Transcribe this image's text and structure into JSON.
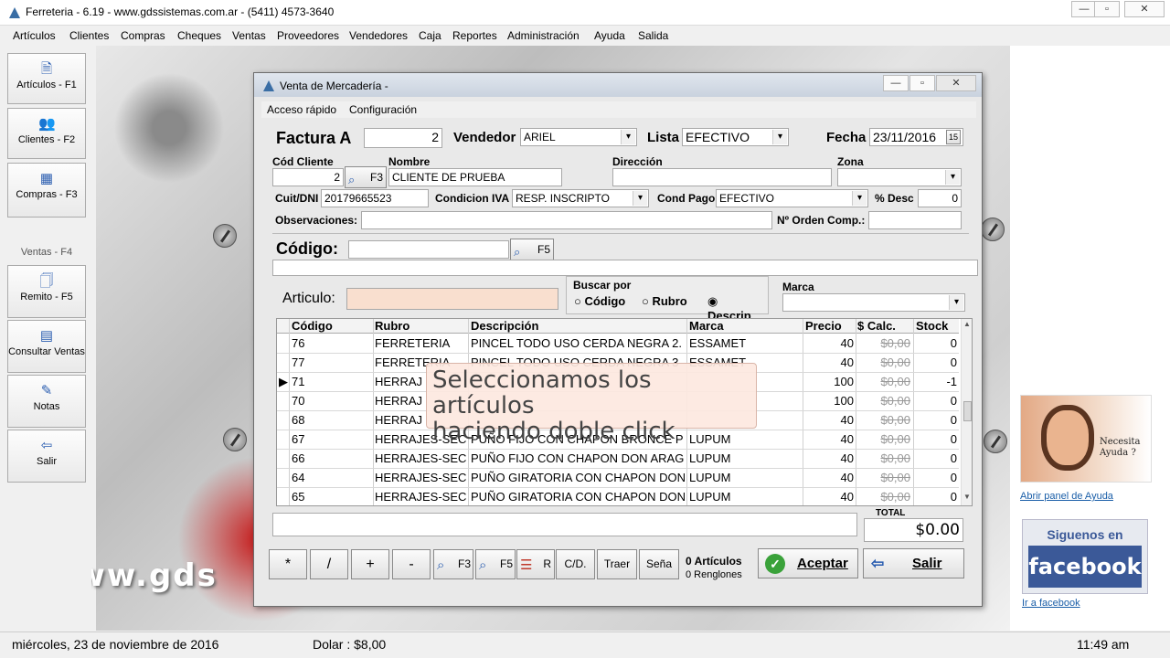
{
  "app": {
    "title": "Ferreteria  -  6.19 - www.gdssistemas.com.ar  -  (5411) 4573-3640"
  },
  "menu": [
    "Artículos",
    "Clientes",
    "Compras",
    "Cheques",
    "Ventas",
    "Proveedores",
    "Vendedores",
    "Caja",
    "Reportes",
    "Administración",
    "Ayuda",
    "Salida"
  ],
  "sidebar": [
    {
      "label": "Artículos - F1",
      "icon": "articles-icon",
      "glyph": "🗎"
    },
    {
      "label": "Clientes - F2",
      "icon": "clients-icon",
      "glyph": "👥"
    },
    {
      "label": "Compras - F3",
      "icon": "purchases-icon",
      "glyph": "▦"
    },
    {
      "label": "Ventas - F4",
      "icon": "",
      "glyph": ""
    },
    {
      "label": "Remito - F5",
      "icon": "delivery-note-icon",
      "glyph": "🗍"
    },
    {
      "label": "Consultar Ventas",
      "icon": "query-sales-icon",
      "glyph": "▤"
    },
    {
      "label": "Notas",
      "icon": "notes-icon",
      "glyph": "✎"
    },
    {
      "label": "Salir",
      "icon": "exit-icon",
      "glyph": "⇦"
    }
  ],
  "watermark": "www.gds",
  "dialog": {
    "title": "Venta de Mercadería -",
    "menu": [
      "Acceso rápido",
      "Configuración"
    ],
    "factura_label": "Factura A",
    "factura_num": "2",
    "vendedor_label": "Vendedor",
    "vendedor_value": "ARIEL",
    "lista_label": "Lista",
    "lista_value": "EFECTIVO",
    "fecha_label": "Fecha",
    "fecha_value": "23/11/2016",
    "calendar_glyph": "15",
    "cod_cliente_label": "Cód Cliente",
    "cod_cliente_value": "2",
    "f3_label": "F3",
    "nombre_label": "Nombre",
    "nombre_value": "CLIENTE DE PRUEBA",
    "direccion_label": "Dirección",
    "direccion_value": "",
    "zona_label": "Zona",
    "zona_value": "",
    "cuit_label": "Cuit/DNI",
    "cuit_value": "20179665523",
    "condicion_iva_label": "Condicion IVA",
    "condicion_iva_value": "RESP. INSCRIPTO",
    "cond_pago_label": "Cond Pago",
    "cond_pago_value": "EFECTIVO",
    "desc_label": "% Desc",
    "desc_value": "0",
    "observaciones_label": "Observaciones:",
    "observaciones_value": "",
    "orden_label": "Nº Orden Comp.:",
    "orden_value": "",
    "codigo_label": "Código:",
    "codigo_value": "",
    "f5_label": "F5",
    "articulo_label": "Articulo:",
    "articulo_value": "",
    "buscar_por_label": "Buscar por",
    "buscar_options": [
      "Código",
      "Rubro",
      "Descrip."
    ],
    "marca_label": "Marca",
    "marca_value": "",
    "columns": [
      "Código",
      "Rubro",
      "Descripción",
      "Marca",
      "Precio",
      "$ Calc.",
      "Stock"
    ],
    "rows": [
      {
        "codigo": "76",
        "rubro": "FERRETERIA",
        "descripcion": "PINCEL TODO USO CERDA NEGRA 2.",
        "marca": "ESSAMET",
        "precio": "40",
        "calc": "$0,00",
        "stock": "0"
      },
      {
        "codigo": "77",
        "rubro": "FERRETERIA",
        "descripcion": "PINCEL TODO USO CERDA NEGRA 3",
        "marca": "ESSAMET",
        "precio": "40",
        "calc": "$0,00",
        "stock": "0"
      },
      {
        "codigo": "71",
        "rubro": "HERRAJ",
        "descripcion": "",
        "marca": "",
        "precio": "100",
        "calc": "$0,00",
        "stock": "-1",
        "current": "▶"
      },
      {
        "codigo": "70",
        "rubro": "HERRAJ",
        "descripcion": "",
        "marca": "",
        "precio": "100",
        "calc": "$0,00",
        "stock": "0"
      },
      {
        "codigo": "68",
        "rubro": "HERRAJ",
        "descripcion": "",
        "marca": "",
        "precio": "40",
        "calc": "$0,00",
        "stock": "0"
      },
      {
        "codigo": "67",
        "rubro": "HERRAJES-SEC",
        "descripcion": "PUÑO FIJO CON CHAPON BRONCE P",
        "marca": "LUPUM",
        "precio": "40",
        "calc": "$0,00",
        "stock": "0"
      },
      {
        "codigo": "66",
        "rubro": "HERRAJES-SEC",
        "descripcion": "PUÑO FIJO CON CHAPON DON ARAG",
        "marca": "LUPUM",
        "precio": "40",
        "calc": "$0,00",
        "stock": "0"
      },
      {
        "codigo": "64",
        "rubro": "HERRAJES-SEC",
        "descripcion": "PUÑO GIRATORIA CON CHAPON DON",
        "marca": "LUPUM",
        "precio": "40",
        "calc": "$0,00",
        "stock": "0"
      },
      {
        "codigo": "65",
        "rubro": "HERRAJES-SEC",
        "descripcion": "PUÑO GIRATORIA CON CHAPON DON",
        "marca": "LUPUM",
        "precio": "40",
        "calc": "$0,00",
        "stock": "0"
      }
    ],
    "tooltip_line1": "Seleccionamos los artículos",
    "tooltip_line2": "haciendo doble click",
    "total_label": "TOTAL",
    "total_value": "$0.00",
    "bottom_buttons": [
      "*",
      "/",
      "+",
      "-"
    ],
    "f3_btn": "F3",
    "f5_btn": "F5",
    "r_btn": "R",
    "cd_btn": "C/D.",
    "traer_btn": "Traer",
    "sena_btn": "Seña",
    "articulos_count": "0 Artículos",
    "renglones_count": "0 Renglones",
    "aceptar_label": "Aceptar",
    "salir_label": "Salir"
  },
  "help": {
    "img_text": "Necesita Ayuda ?",
    "link": "Abrir panel de Ayuda",
    "siguenos": "Siguenos en",
    "facebook": "facebook",
    "fb_link": "Ir a facebook"
  },
  "status": {
    "date": "miércoles, 23 de noviembre de 2016",
    "dolar": "Dolar : $8,00",
    "time": "11:49 am"
  }
}
